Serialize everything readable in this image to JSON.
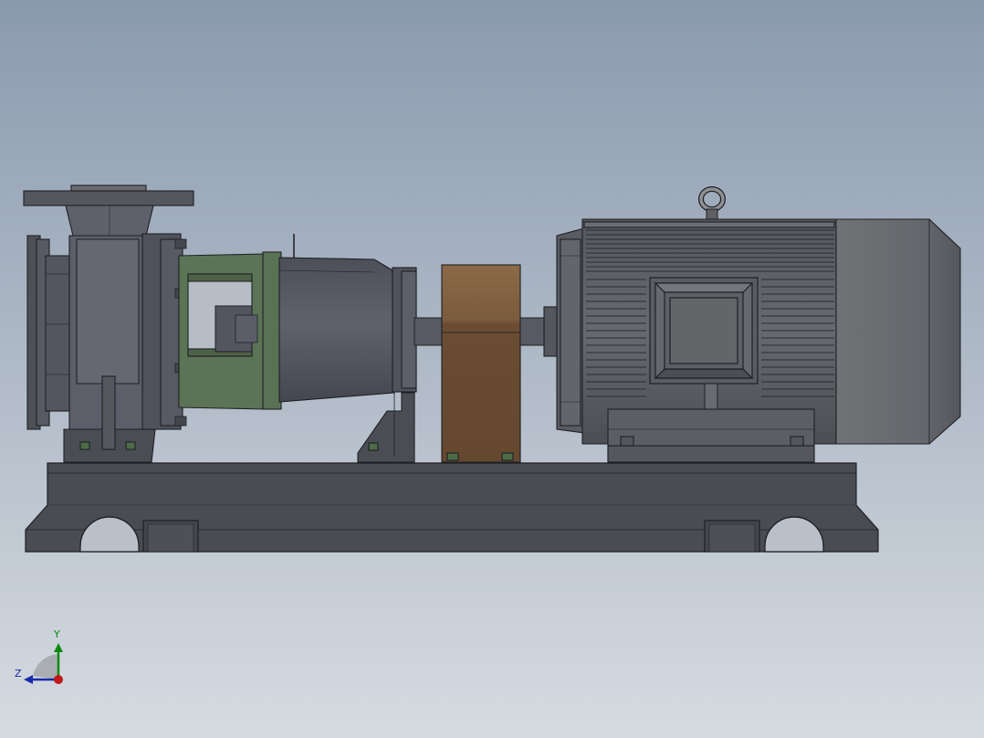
{
  "viewport": {
    "background_top": "#8a9aae",
    "background_bottom": "#d6dbe1"
  },
  "model": {
    "name": "centrifugal-pump-motor-assembly",
    "colors": {
      "body_dark": "#4a4c54",
      "body_mid": "#5b5e68",
      "body_light": "#6e717b",
      "bracket_green": "#5c7456",
      "coupling_guard": "#7a5a3c",
      "motor_gray": "#5d5f66",
      "motor_fan_cover": "#6b6d72",
      "edge": "#1f2024"
    }
  },
  "triad": {
    "y_label": "Y",
    "z_label": "Z",
    "colors": {
      "y": "#0a8a0a",
      "z": "#1a2aa8",
      "x": "#c01818"
    }
  }
}
